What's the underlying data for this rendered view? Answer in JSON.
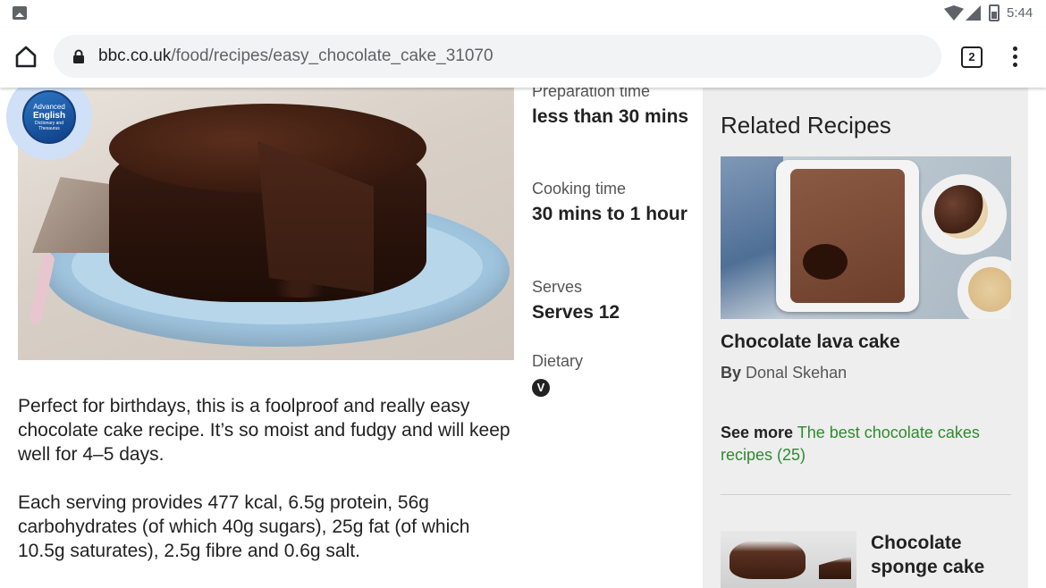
{
  "status_bar": {
    "time": "5:44",
    "icons": [
      "image-icon",
      "wifi-icon",
      "signal-icon",
      "battery-icon"
    ]
  },
  "browser": {
    "url_host": "bbc.co.uk",
    "url_path": "/food/recipes/easy_chocolate_cake_31070",
    "tab_count": "2"
  },
  "overlay_badge": {
    "line1": "Advanced",
    "line2": "English",
    "line3": "Dictionary and",
    "line4": "Thesaurus"
  },
  "recipe": {
    "info": [
      {
        "label": "Preparation time",
        "value": "less than 30 mins"
      },
      {
        "label": "Cooking time",
        "value": "30 mins to 1 hour"
      },
      {
        "label": "Serves",
        "value": "Serves 12"
      },
      {
        "label": "Dietary",
        "value": "V"
      }
    ],
    "description": [
      "Perfect for birthdays, this is a foolproof and really easy chocolate cake recipe. It’s so moist and fudgy and will keep well for 4–5 days.",
      "Each serving provides 477 kcal, 6.5g protein, 56g carbohydrates (of which 40g sugars), 25g fat (of which 10.5g saturates), 2.5g fibre and 0.6g salt."
    ]
  },
  "sidebar": {
    "title": "Related Recipes",
    "card": {
      "title": "Chocolate lava cake",
      "author_prefix": "By",
      "author": "Donal Skehan"
    },
    "see_more": {
      "prefix": "See more",
      "link": "The best chocolate cakes recipes (25)"
    },
    "card2_title": "Chocolate sponge cake"
  },
  "colors": {
    "link_green": "#2e8b2e",
    "sidebar_bg": "#eeeeee",
    "url_bar_bg": "#f1f3f4"
  }
}
